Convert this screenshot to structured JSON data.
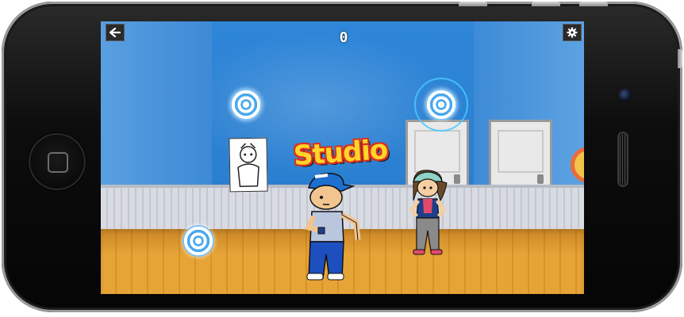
{
  "hud": {
    "back_icon": "arrow-left-icon",
    "settings_icon": "gear-icon",
    "score": "0"
  },
  "scene": {
    "sign_text": "Studio"
  },
  "targets": [
    {
      "name": "tap-target-1",
      "active": false
    },
    {
      "name": "tap-target-2",
      "active": true
    },
    {
      "name": "tap-target-3",
      "active": false
    }
  ],
  "colors": {
    "wall": "#2f86d8",
    "floor": "#e6a437",
    "target_blue": "#49a8ee",
    "sign_yellow": "#ffd52a",
    "sign_red": "#d9311f"
  }
}
